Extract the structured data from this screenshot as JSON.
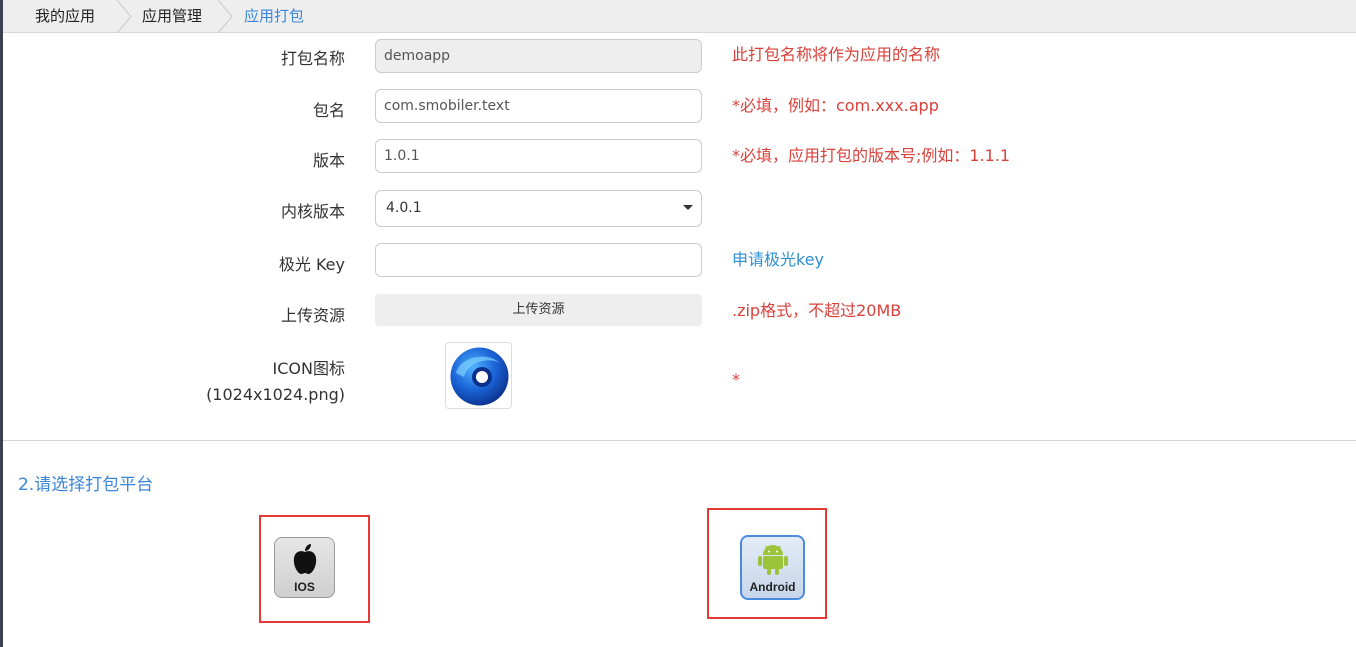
{
  "breadcrumb": {
    "items": [
      "我的应用",
      "应用管理",
      "应用打包"
    ]
  },
  "form": {
    "package_name": {
      "label": "打包名称",
      "value": "demoapp",
      "hint": "此打包名称将作为应用的名称"
    },
    "bundle_id": {
      "label": "包名",
      "value": "com.smobiler.text",
      "hint": "*必填，例如：com.xxx.app"
    },
    "version": {
      "label": "版本",
      "value": "1.0.1",
      "hint": "*必填，应用打包的版本号;例如：1.1.1"
    },
    "kernel_version": {
      "label": "内核版本",
      "value": "4.0.1"
    },
    "jpush_key": {
      "label": "极光 Key",
      "value": "",
      "hint": "申请极光key"
    },
    "upload": {
      "label": "上传资源",
      "button": "上传资源",
      "hint": ".zip格式，不超过20MB"
    },
    "icon": {
      "label_line1": "ICON图标",
      "label_line2": "(1024x1024.png)",
      "hint": "*"
    }
  },
  "platform_section": {
    "title": "2.请选择打包平台",
    "ios_label": "IOS",
    "android_label": "Android"
  },
  "colors": {
    "accent": "#3a86d9",
    "hint_red": "#d9413b",
    "link_blue": "#2e8fd1",
    "highlight_red": "#e53935"
  }
}
